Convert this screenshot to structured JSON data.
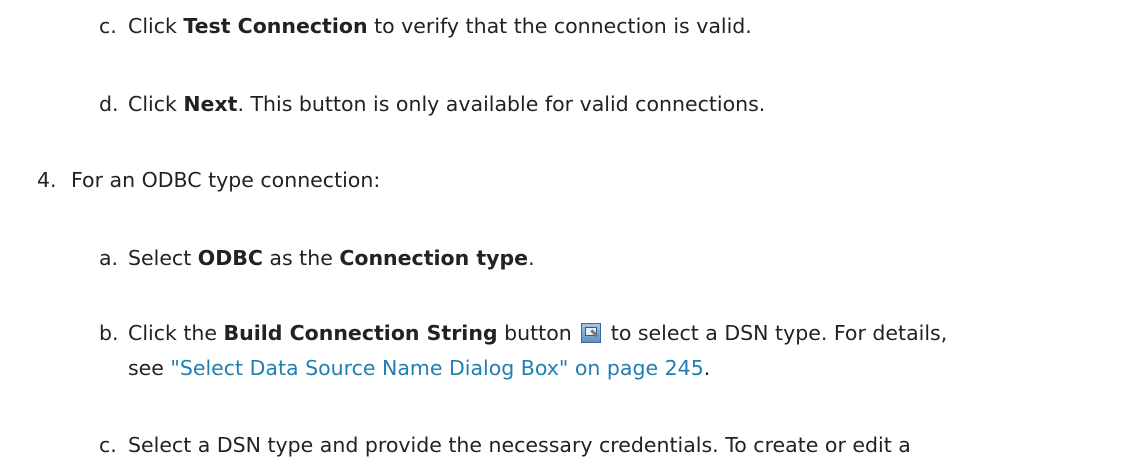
{
  "step_c1": {
    "marker": "c.",
    "t1": "Click ",
    "b1": "Test Connection",
    "t2": " to verify that the connection is valid."
  },
  "step_d1": {
    "marker": "d.",
    "t1": "Click ",
    "b1": "Next",
    "t2": ". This button is only available for valid connections."
  },
  "step_4": {
    "marker": "4.",
    "t1": "For an ODBC type connection:"
  },
  "step_a": {
    "marker": "a.",
    "t1": "Select ",
    "b1": "ODBC",
    "t2": " as the ",
    "b2": "Connection type",
    "t3": "."
  },
  "step_b": {
    "marker": "b.",
    "t1": "Click the ",
    "b1": "Build Connection String",
    "t2": " button ",
    "icon": "build-connection-string-icon",
    "t3": " to select a DSN type. For details,",
    "line2_prefix": "see ",
    "link": "\"Select Data Source Name Dialog Box\" on page 245",
    "line2_suffix": "."
  },
  "step_c2": {
    "marker": "c.",
    "t1": "Select a DSN type and provide the necessary credentials. To create or edit a"
  },
  "colors": {
    "text": "#222222",
    "link": "#1f7fb3",
    "background": "#ffffff"
  }
}
